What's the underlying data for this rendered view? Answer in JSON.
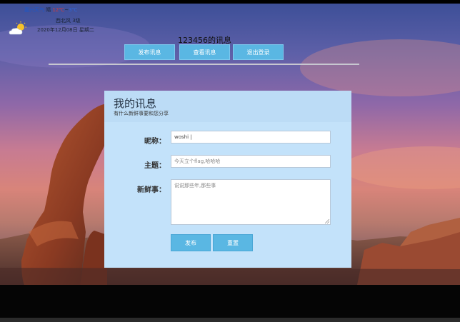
{
  "weather": {
    "city": "嘉兴天气",
    "condition": "晴",
    "temp_high": "12℃",
    "temp_sep": "~",
    "temp_low": "3℃",
    "wind": "西北风 3级",
    "date": "2020年12月08日 星期二",
    "icon": "partly-cloudy-icon"
  },
  "page_title": "123456的讯息",
  "nav": {
    "publish": "发布讯息",
    "view": "查看讯息",
    "logout": "退出登录"
  },
  "form": {
    "title": "我的讯息",
    "subtitle": "有什么新鲜事要和您分享",
    "nickname_label": "昵称：",
    "nickname_value": "woshi |",
    "topic_label": "主题：",
    "topic_placeholder": "今天立个flag,哈哈哈",
    "news_label": "新鲜事：",
    "news_placeholder": "说说那些年,那些事",
    "submit_label": "发布",
    "reset_label": "重置"
  },
  "colors": {
    "accent": "#5ab7e3",
    "card": "#c3e2fa"
  }
}
